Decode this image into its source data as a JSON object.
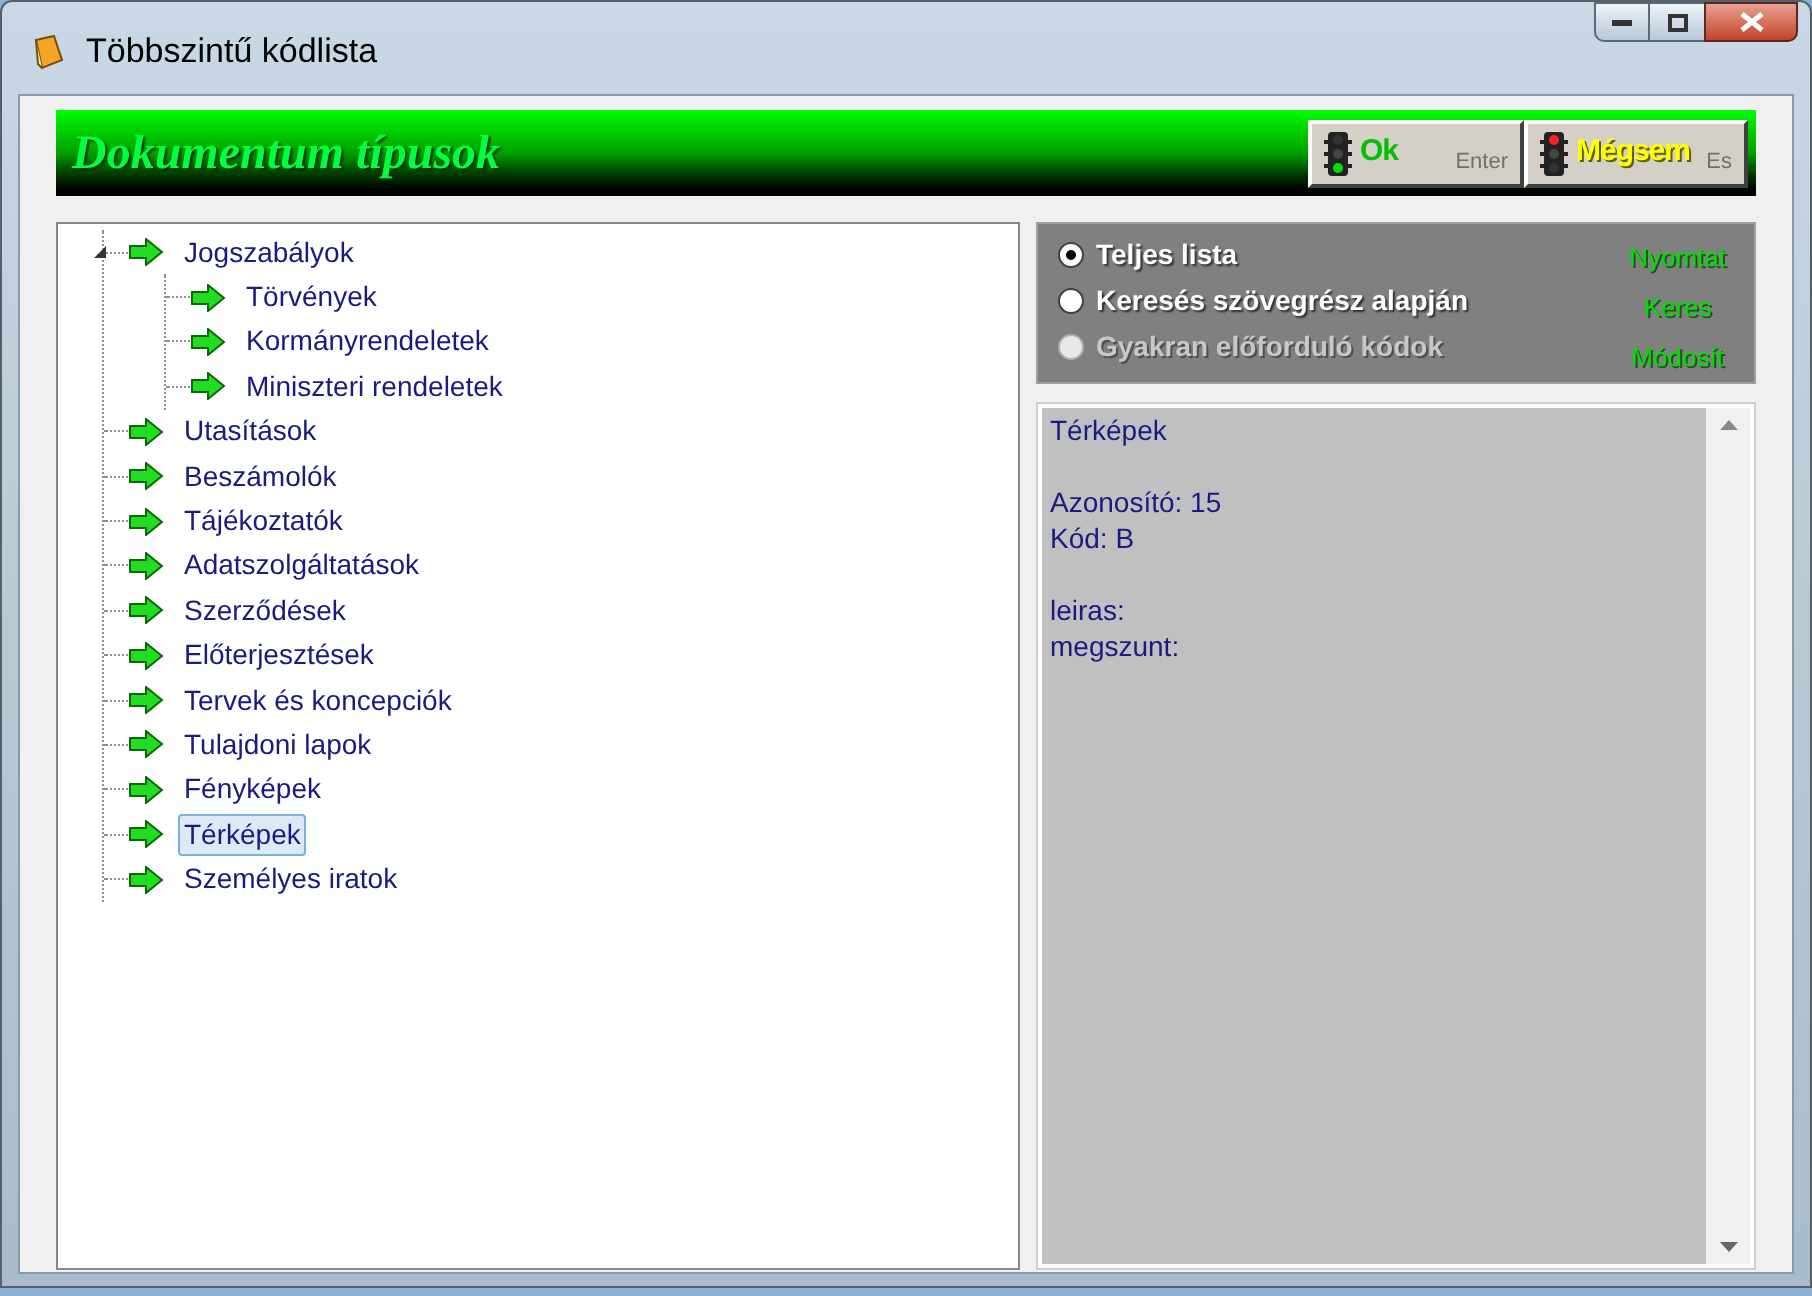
{
  "window": {
    "title": "Többszintű kódlista"
  },
  "header": {
    "title": "Dokumentum típusok",
    "buttons": [
      {
        "kind": "ok",
        "label": "Ok",
        "hint": "Enter"
      },
      {
        "kind": "cancel",
        "label": "Mégsem",
        "hint": "Es"
      }
    ]
  },
  "tree": [
    {
      "label": "Jogszabályok",
      "selected": false,
      "expanded": true,
      "children": [
        {
          "label": "Törvények",
          "selected": false
        },
        {
          "label": "Kormányrendeletek",
          "selected": false
        },
        {
          "label": "Miniszteri rendeletek",
          "selected": false
        }
      ]
    },
    {
      "label": "Utasítások",
      "selected": false
    },
    {
      "label": "Beszámolók",
      "selected": false
    },
    {
      "label": "Tájékoztatók",
      "selected": false
    },
    {
      "label": "Adatszolgáltatások",
      "selected": false
    },
    {
      "label": "Szerződések",
      "selected": false
    },
    {
      "label": "Előterjesztések",
      "selected": false
    },
    {
      "label": "Tervek és koncepciók",
      "selected": false
    },
    {
      "label": "Tulajdoni lapok",
      "selected": false
    },
    {
      "label": "Fényképek",
      "selected": false
    },
    {
      "label": "Térképek",
      "selected": true
    },
    {
      "label": "Személyes iratok",
      "selected": false
    }
  ],
  "options": [
    {
      "label": "Teljes lista",
      "selected": true,
      "disabled": false
    },
    {
      "label": "Keresés szövegrész alapján",
      "selected": false,
      "disabled": false
    },
    {
      "label": "Gyakran előforduló kódok",
      "selected": false,
      "disabled": true
    }
  ],
  "actions": [
    "Nyomtat",
    "Keres",
    "Módosít"
  ],
  "details": [
    [
      "Térképek"
    ],
    [
      "Azonosító: 15",
      "Kód: B"
    ],
    [
      "leiras:",
      "megszunt:"
    ]
  ]
}
